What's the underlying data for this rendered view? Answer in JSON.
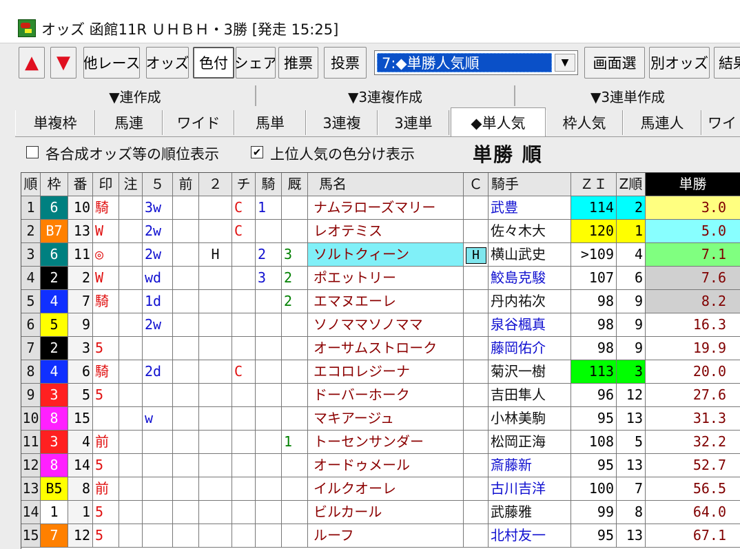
{
  "window": {
    "title": "オッズ 函館11R ＵＨＢＨ・3勝 [発走 15:25]"
  },
  "toolbar": {
    "up_icon": "▲",
    "down_icon": "▼",
    "buttons": [
      "他レース",
      "オッズ",
      "色付",
      "シェア",
      "推票",
      "投票"
    ],
    "sort_select": "7:◆単勝人気順",
    "dropdown_icon": "▼",
    "right_buttons": [
      "画面選",
      "別オッズ",
      "結果"
    ]
  },
  "groups": [
    "▼連作成",
    "▼3連複作成",
    "▼3連単作成"
  ],
  "tabs": [
    "単複枠",
    "馬連",
    "ワイド",
    "馬単",
    "3連複",
    "3連単",
    "◆単人気",
    "枠人気",
    "馬連人",
    "ワイ"
  ],
  "options": {
    "rank_display": {
      "label": "各合成オッズ等の順位表示",
      "checked": false
    },
    "color_display": {
      "label": "上位人気の色分け表示",
      "checked": true
    },
    "check_mark": "✔"
  },
  "heading": "単勝 順",
  "colors": {
    "frame1": "#ffffff",
    "frame2": "#000000",
    "frame3": "#ff2020",
    "frame4": "#1030ff",
    "frame5": "#ffff00",
    "frame6": "#008080",
    "frame7": "#ff8000",
    "frame8": "#ff20ff",
    "rank1_bg": "#ffff80",
    "rank2_bg": "#88ffff",
    "rank3_bg": "#80ff80",
    "rank4_bg": "#d0d0d0",
    "zi_rank1_bg": "#ffff00",
    "zi_rank2_bg": "#00ffff",
    "zi_rank3_bg": "#00ff00",
    "odds_text": "#800000"
  },
  "table": {
    "columns": [
      "順",
      "枠",
      "番",
      "印",
      "注",
      "５",
      "前",
      "２",
      "チ",
      "騎",
      "厩",
      "馬名",
      "Ｃ",
      "騎手",
      "ＺＩ",
      "Z順",
      "単勝"
    ],
    "rows": [
      {
        "rank": "1",
        "frame": "6",
        "num": "10",
        "mark": "騎",
        "note": "",
        "five": "3w",
        "mae": "",
        "two": "",
        "chi": "C",
        "ki": "1",
        "kyu": "",
        "horse": "ナムラローズマリー",
        "c": "",
        "jockey": "武豊",
        "jockey_blue": true,
        "zi": "114",
        "zi_rank": "2",
        "odds": "3.0"
      },
      {
        "rank": "2",
        "frame": "B7",
        "num": "13",
        "mark": "W",
        "note": "",
        "five": "2w",
        "mae": "",
        "two": "",
        "chi": "C",
        "ki": "",
        "kyu": "",
        "horse": "レオテミス",
        "c": "",
        "jockey": "佐々木大",
        "jockey_blue": false,
        "zi": "120",
        "zi_rank": "1",
        "odds": "5.0"
      },
      {
        "rank": "3",
        "frame": "6",
        "num": "11",
        "mark": "◎",
        "note": "",
        "five": "2w",
        "mae": "",
        "two": "H",
        "chi": "",
        "ki": "2",
        "kyu": "3",
        "horse": "ソルトクィーン",
        "c": "H",
        "jockey": "横山武史",
        "jockey_blue": false,
        "zi": ">109",
        "zi_rank": "4",
        "odds": "7.1"
      },
      {
        "rank": "4",
        "frame": "2",
        "num": "2",
        "mark": "W",
        "note": "",
        "five": "wd",
        "mae": "",
        "two": "",
        "chi": "",
        "ki": "3",
        "kyu": "2",
        "horse": "ポエットリー",
        "c": "",
        "jockey": "鮫島克駿",
        "jockey_blue": true,
        "zi": "107",
        "zi_rank": "6",
        "odds": "7.6"
      },
      {
        "rank": "5",
        "frame": "4",
        "num": "7",
        "mark": "騎",
        "note": "",
        "five": "1d",
        "mae": "",
        "two": "",
        "chi": "",
        "ki": "",
        "kyu": "2",
        "horse": "エマヌエーレ",
        "c": "",
        "jockey": "丹内祐次",
        "jockey_blue": false,
        "zi": "98",
        "zi_rank": "9",
        "odds": "8.2"
      },
      {
        "rank": "6",
        "frame": "5",
        "num": "9",
        "mark": "",
        "note": "",
        "five": "2w",
        "mae": "",
        "two": "",
        "chi": "",
        "ki": "",
        "kyu": "",
        "horse": "ソノママソノママ",
        "c": "",
        "jockey": "泉谷楓真",
        "jockey_blue": true,
        "zi": "98",
        "zi_rank": "9",
        "odds": "16.3"
      },
      {
        "rank": "7",
        "frame": "2",
        "num": "3",
        "mark": "5",
        "note": "",
        "five": "",
        "mae": "",
        "two": "",
        "chi": "",
        "ki": "",
        "kyu": "",
        "horse": "オーサムストローク",
        "c": "",
        "jockey": "藤岡佑介",
        "jockey_blue": true,
        "zi": "98",
        "zi_rank": "9",
        "odds": "19.9"
      },
      {
        "rank": "8",
        "frame": "4",
        "num": "6",
        "mark": "騎",
        "note": "",
        "five": "2d",
        "mae": "",
        "two": "",
        "chi": "C",
        "ki": "",
        "kyu": "",
        "horse": "エコロレジーナ",
        "c": "",
        "jockey": "菊沢一樹",
        "jockey_blue": false,
        "zi": "113",
        "zi_rank": "3",
        "odds": "20.0"
      },
      {
        "rank": "9",
        "frame": "3",
        "num": "5",
        "mark": "5",
        "note": "",
        "five": "",
        "mae": "",
        "two": "",
        "chi": "",
        "ki": "",
        "kyu": "",
        "horse": "ドーバーホーク",
        "c": "",
        "jockey": "吉田隼人",
        "jockey_blue": false,
        "zi": "96",
        "zi_rank": "12",
        "odds": "27.6"
      },
      {
        "rank": "10",
        "frame": "8",
        "num": "15",
        "mark": "",
        "note": "",
        "five": "w",
        "mae": "",
        "two": "",
        "chi": "",
        "ki": "",
        "kyu": "",
        "horse": "マキアージュ",
        "c": "",
        "jockey": "小林美駒",
        "jockey_blue": false,
        "zi": "95",
        "zi_rank": "13",
        "odds": "31.3"
      },
      {
        "rank": "11",
        "frame": "3",
        "num": "4",
        "mark": "前",
        "note": "",
        "five": "",
        "mae": "",
        "two": "",
        "chi": "",
        "ki": "",
        "kyu": "1",
        "horse": "トーセンサンダー",
        "c": "",
        "jockey": "松岡正海",
        "jockey_blue": false,
        "zi": "108",
        "zi_rank": "5",
        "odds": "32.2"
      },
      {
        "rank": "12",
        "frame": "8",
        "num": "14",
        "mark": "5",
        "note": "",
        "five": "",
        "mae": "",
        "two": "",
        "chi": "",
        "ki": "",
        "kyu": "",
        "horse": "オードゥメール",
        "c": "",
        "jockey": "斎藤新",
        "jockey_blue": true,
        "zi": "95",
        "zi_rank": "13",
        "odds": "52.7"
      },
      {
        "rank": "13",
        "frame": "B5",
        "num": "8",
        "mark": "前",
        "note": "",
        "five": "",
        "mae": "",
        "two": "",
        "chi": "",
        "ki": "",
        "kyu": "",
        "horse": "イルクオーレ",
        "c": "",
        "jockey": "古川吉洋",
        "jockey_blue": true,
        "zi": "100",
        "zi_rank": "7",
        "odds": "56.5"
      },
      {
        "rank": "14",
        "frame": "1",
        "num": "1",
        "mark": "5",
        "note": "",
        "five": "",
        "mae": "",
        "two": "",
        "chi": "",
        "ki": "",
        "kyu": "",
        "horse": "ビルカール",
        "c": "",
        "jockey": "武藤雅",
        "jockey_blue": false,
        "zi": "99",
        "zi_rank": "8",
        "odds": "64.0"
      },
      {
        "rank": "15",
        "frame": "7",
        "num": "12",
        "mark": "5",
        "note": "",
        "five": "",
        "mae": "",
        "two": "",
        "chi": "",
        "ki": "",
        "kyu": "",
        "horse": "ルーフ",
        "c": "",
        "jockey": "北村友一",
        "jockey_blue": true,
        "zi": "95",
        "zi_rank": "13",
        "odds": "67.1"
      }
    ]
  }
}
